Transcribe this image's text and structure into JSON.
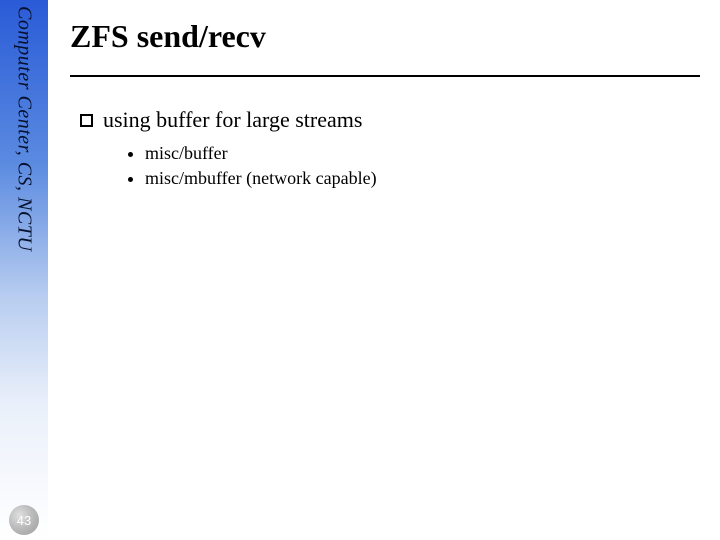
{
  "sidebar": {
    "text": "Computer Center, CS, NCTU"
  },
  "page_number": "43",
  "title": "ZFS send/recv",
  "bullets": {
    "level1": "using buffer for large streams",
    "level2a": "misc/buffer",
    "level2b": "misc/mbuffer (network capable)"
  }
}
